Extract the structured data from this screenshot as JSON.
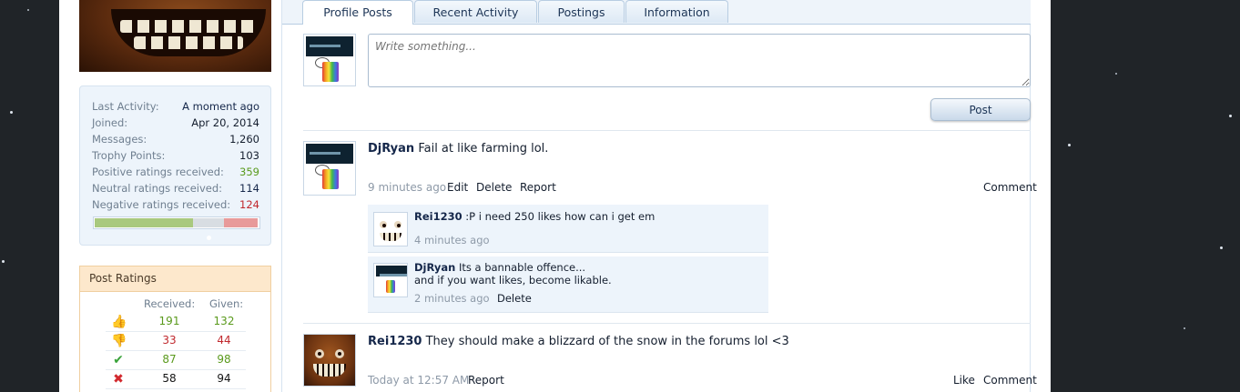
{
  "stats": {
    "rows": [
      {
        "label": "Last Activity:",
        "value": "A moment ago"
      },
      {
        "label": "Joined:",
        "value": "Apr 20, 2014"
      },
      {
        "label": "Messages:",
        "value": "1,260"
      },
      {
        "label": "Trophy Points:",
        "value": "103"
      },
      {
        "label": "Positive ratings received:",
        "value": "359"
      },
      {
        "label": "Neutral ratings received:",
        "value": "114"
      },
      {
        "label": "Negative ratings received:",
        "value": "124"
      }
    ],
    "rating_bar": {
      "positive": 359,
      "neutral": 114,
      "negative": 124
    },
    "colors": {
      "positive": "#a9c97e",
      "neutral": "#d8dde2",
      "negative": "#e89a9a"
    }
  },
  "post_ratings": {
    "title": "Post Ratings",
    "received_label": "Received:",
    "given_label": "Given:",
    "rows": [
      {
        "icon": "thumbs-up-icon",
        "received": "191",
        "given": "132"
      },
      {
        "icon": "thumbs-down-icon",
        "received": "33",
        "given": "44"
      },
      {
        "icon": "checkmark-icon",
        "received": "87",
        "given": "98"
      },
      {
        "icon": "red-x-icon",
        "received": "58",
        "given": "94"
      }
    ]
  },
  "tabs": [
    {
      "label": "Profile Posts",
      "active": true
    },
    {
      "label": "Recent Activity",
      "active": false
    },
    {
      "label": "Postings",
      "active": false
    },
    {
      "label": "Information",
      "active": false
    }
  ],
  "composer": {
    "placeholder": "Write something...",
    "post_label": "Post"
  },
  "posts": [
    {
      "author": "DjRyan",
      "text": "Fail at like farming lol.",
      "time": "9 minutes ago",
      "actions": [
        "Edit",
        "Delete",
        "Report"
      ],
      "right_actions": [
        "Comment"
      ],
      "comments": [
        {
          "author": "Rei1230",
          "text": ":P i need 250 likes how can i get em",
          "time": "4 minutes ago",
          "actions": []
        },
        {
          "author": "DjRyan",
          "text": "Its a bannable offence...",
          "text2": "and if you want likes, become likable.",
          "time": "2 minutes ago",
          "actions": [
            "Delete"
          ]
        }
      ]
    },
    {
      "author": "Rei1230",
      "text": "They should make a blizzard of the snow in the forums lol <3",
      "time": "Today at 12:57 AM",
      "actions": [
        "Report"
      ],
      "right_actions": [
        "Like",
        "Comment"
      ]
    }
  ]
}
